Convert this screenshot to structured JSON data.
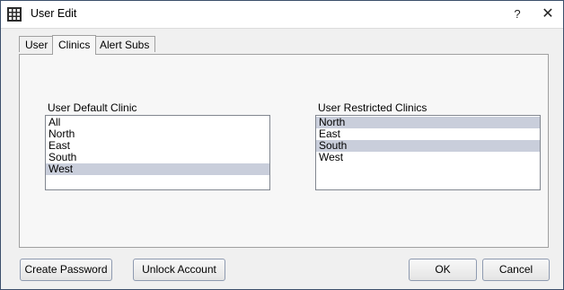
{
  "window": {
    "title": "User Edit",
    "help_label": "?",
    "close_label": "✕"
  },
  "tabs": [
    {
      "label": "User",
      "active": false
    },
    {
      "label": "Clinics",
      "active": true
    },
    {
      "label": "Alert Subs",
      "active": false
    }
  ],
  "default_clinic": {
    "label": "User Default Clinic",
    "items": [
      {
        "label": "All",
        "selected": false
      },
      {
        "label": "North",
        "selected": false
      },
      {
        "label": "East",
        "selected": false
      },
      {
        "label": "South",
        "selected": false
      },
      {
        "label": "West",
        "selected": true
      }
    ]
  },
  "restricted_clinics": {
    "label": "User Restricted Clinics",
    "items": [
      {
        "label": "North",
        "selected": true
      },
      {
        "label": "East",
        "selected": false
      },
      {
        "label": "South",
        "selected": true
      },
      {
        "label": "West",
        "selected": false
      }
    ]
  },
  "buttons": {
    "create_password": "Create Password",
    "unlock_account": "Unlock Account",
    "ok": "OK",
    "cancel": "Cancel"
  },
  "colors": {
    "selection": "#c9cedb",
    "window_border": "#3c4f6b"
  }
}
